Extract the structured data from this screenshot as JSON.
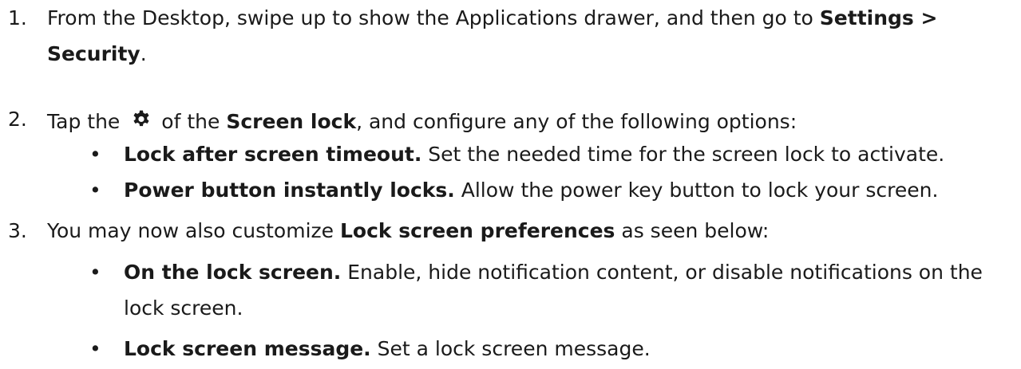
{
  "steps": [
    {
      "number": "1.",
      "line1_prefix": "From the Desktop, swipe up to show the Applications drawer, and then go to ",
      "line1_bold": "Settings >",
      "line2_bold": "Security",
      "line2_suffix": "."
    },
    {
      "number": "2.",
      "prefix": "Tap the",
      "icon": "gear-icon",
      "middle": "of the ",
      "bold": "Screen lock",
      "suffix": ", and configure any of the following options:",
      "bullets": [
        {
          "bold": "Lock after screen timeout.",
          "text": " Set the needed time for the screen lock to activate."
        },
        {
          "bold": "Power button instantly locks.",
          "text": " Allow the power key button to lock your screen."
        }
      ]
    },
    {
      "number": "3.",
      "prefix": "You may now also customize ",
      "bold": "Lock screen preferences",
      "suffix": " as seen below:",
      "bullets": [
        {
          "bold": "On the lock screen.",
          "text": " Enable, hide notification content, or disable notifications on the",
          "text_line2": "lock screen."
        },
        {
          "bold": "Lock screen message.",
          "text": " Set a lock screen message."
        }
      ]
    }
  ],
  "bullet_char": "•"
}
